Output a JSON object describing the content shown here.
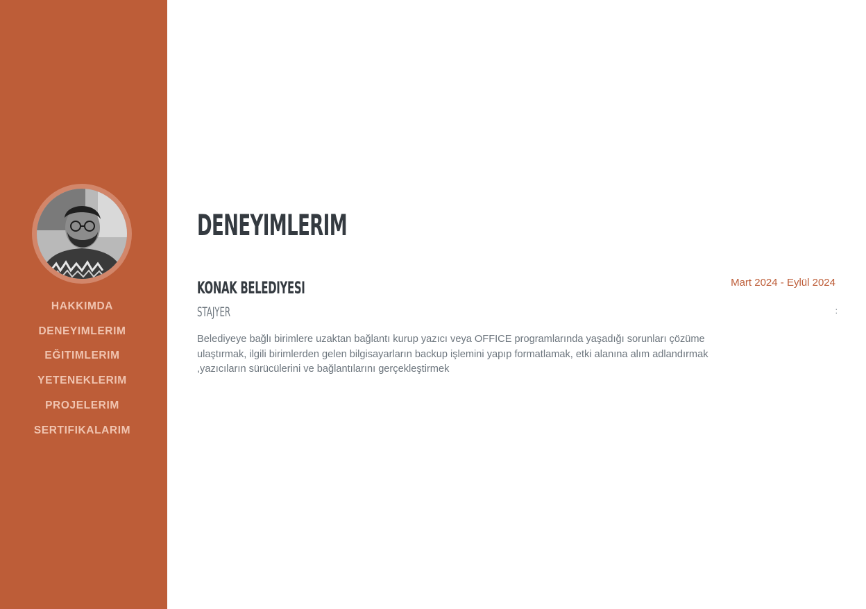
{
  "colors": {
    "sidebar_bg": "#bd5d38",
    "nav_text": "#f0c4b0",
    "heading": "#343a40",
    "muted": "#6c757d",
    "accent": "#bd5d38"
  },
  "sidebar": {
    "avatar_icon": "profile-photo",
    "nav_items": [
      {
        "label": "HAKKIMDA"
      },
      {
        "label": "DENEYIMLERIM"
      },
      {
        "label": "EĞITIMLERIM"
      },
      {
        "label": "YETENEKLERIM"
      },
      {
        "label": "PROJELERIM"
      },
      {
        "label": "SERTIFIKALARIM"
      }
    ]
  },
  "main": {
    "section_title": "DENEYIMLERIM",
    "experience": {
      "company": "KONAK BELEDIYESI",
      "role": "STAJYER",
      "description": "Belediyeye bağlı birimlere uzaktan bağlantı kurup yazıcı veya OFFICE programlarında yaşadığı sorunları çözüme ulaştırmak, ilgili birimlerden gelen bilgisayarların backup işlemini yapıp formatlamak, etki alanına alım adlandırmak ,yazıcıların sürücülerini ve bağlantılarını gerçekleştirmek",
      "date": "Mart 2024 - Eylül 2024",
      "edge_mark": ":"
    }
  }
}
